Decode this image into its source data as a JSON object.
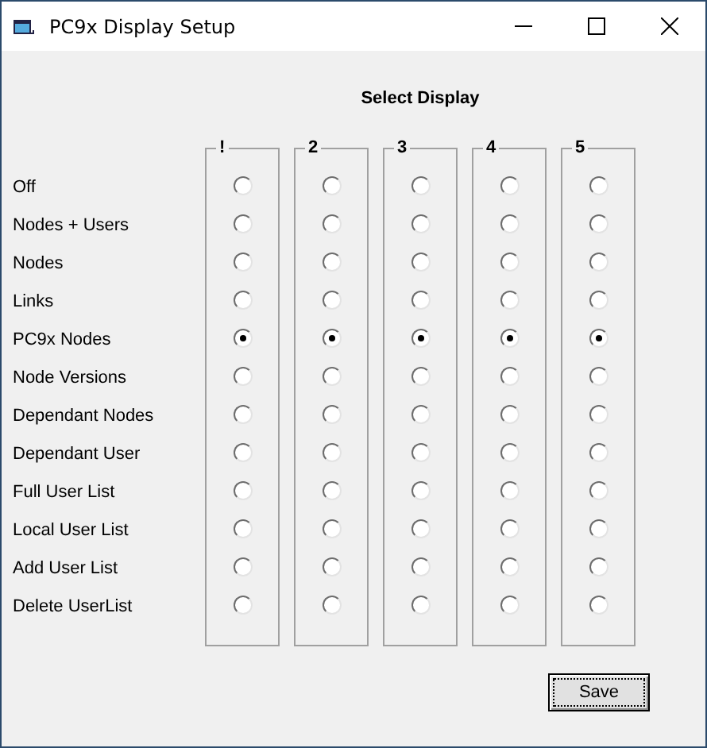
{
  "window": {
    "title": "PC9x Display Setup"
  },
  "heading": "Select Display",
  "row_labels": [
    "Off",
    "Nodes + Users",
    "Nodes",
    "Links",
    "PC9x Nodes",
    "Node Versions",
    "Dependant Nodes",
    "Dependant User",
    "Full User List",
    "Local User List",
    "Add User List",
    "Delete UserList"
  ],
  "columns": [
    {
      "label": "!",
      "options": [
        {
          "selected": false
        },
        {
          "selected": false
        },
        {
          "selected": false
        },
        {
          "selected": false
        },
        {
          "selected": true
        },
        {
          "selected": false
        },
        {
          "selected": false
        },
        {
          "selected": false
        },
        {
          "selected": false
        },
        {
          "selected": false
        },
        {
          "selected": false
        },
        {
          "selected": false
        }
      ]
    },
    {
      "label": "2",
      "options": [
        {
          "selected": false
        },
        {
          "selected": false
        },
        {
          "selected": false
        },
        {
          "selected": false
        },
        {
          "selected": true
        },
        {
          "selected": false
        },
        {
          "selected": false
        },
        {
          "selected": false
        },
        {
          "selected": false
        },
        {
          "selected": false
        },
        {
          "selected": false
        },
        {
          "selected": false
        }
      ]
    },
    {
      "label": "3",
      "options": [
        {
          "selected": false
        },
        {
          "selected": false
        },
        {
          "selected": false
        },
        {
          "selected": false
        },
        {
          "selected": true
        },
        {
          "selected": false
        },
        {
          "selected": false
        },
        {
          "selected": false
        },
        {
          "selected": false
        },
        {
          "selected": false
        },
        {
          "selected": false
        },
        {
          "selected": false
        }
      ]
    },
    {
      "label": "4",
      "options": [
        {
          "selected": false
        },
        {
          "selected": false
        },
        {
          "selected": false
        },
        {
          "selected": false
        },
        {
          "selected": true
        },
        {
          "selected": false
        },
        {
          "selected": false
        },
        {
          "selected": false
        },
        {
          "selected": false
        },
        {
          "selected": false
        },
        {
          "selected": false
        },
        {
          "selected": false
        }
      ]
    },
    {
      "label": "5",
      "options": [
        {
          "selected": false
        },
        {
          "selected": false
        },
        {
          "selected": false
        },
        {
          "selected": false
        },
        {
          "selected": true
        },
        {
          "selected": false
        },
        {
          "selected": false
        },
        {
          "selected": false
        },
        {
          "selected": false
        },
        {
          "selected": false
        },
        {
          "selected": false
        },
        {
          "selected": false
        }
      ]
    }
  ],
  "buttons": [
    {
      "label": "Save"
    }
  ]
}
